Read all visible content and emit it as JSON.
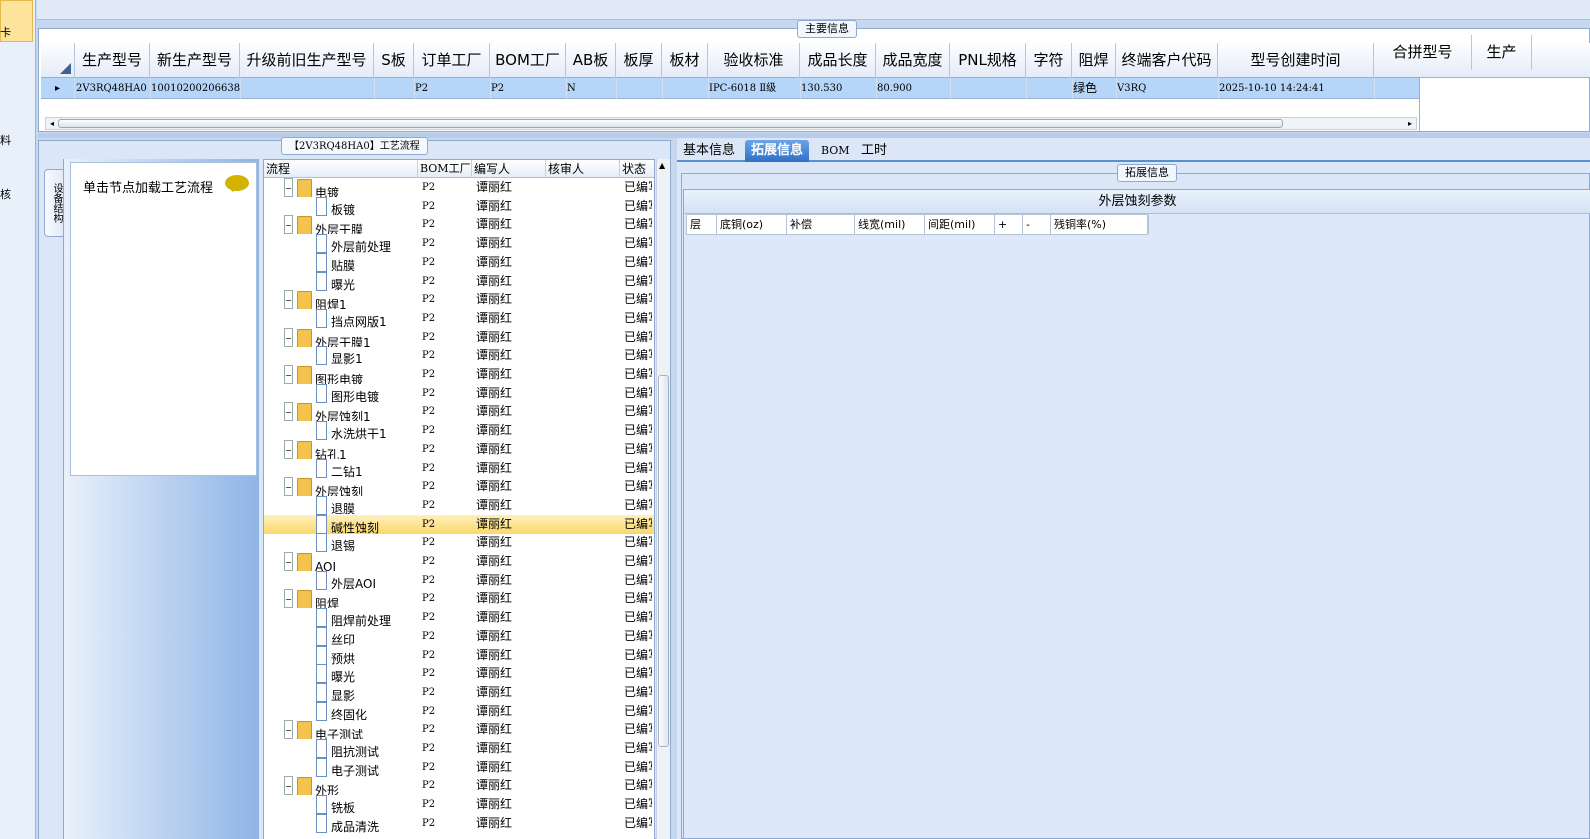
{
  "left_strip": {
    "labels": [
      "卡",
      "料",
      "核"
    ]
  },
  "main_info": {
    "title": "主要信息",
    "columns": [
      "生产型号",
      "新生产型号",
      "升级前旧生产型号",
      "S板",
      "订单工厂",
      "BOM工厂",
      "AB板",
      "板厚",
      "板材",
      "验收标准",
      "成品长度",
      "成品宽度",
      "PNL规格",
      "字符",
      "阻焊",
      "终端客户代码",
      "型号创建时间",
      "合拼型号",
      "生产"
    ],
    "row": [
      "2V3RQ48HA0",
      "10010200206638",
      "",
      "",
      "P2",
      "P2",
      "N",
      "",
      "",
      "IPC-6018 Ⅱ级",
      "130.530",
      "80.900",
      "",
      "",
      "绿色",
      "V3RQ",
      "2025-10-10 14:24:41"
    ]
  },
  "flow": {
    "title": "【2V3RQ48HA0】工艺流程",
    "side_tab": "设备结构",
    "node_hint": "单击节点加载工艺流程",
    "columns": [
      "流程",
      "BOM工厂",
      "编写人",
      "核审人",
      "状态"
    ],
    "rows": [
      {
        "name": "电镀",
        "level": 0,
        "bom": "P2",
        "writer": "谭丽红",
        "status": "已编写"
      },
      {
        "name": "板镀",
        "level": 1,
        "bom": "P2",
        "writer": "谭丽红",
        "status": "已编写"
      },
      {
        "name": "外层干膜",
        "level": 0,
        "bom": "P2",
        "writer": "谭丽红",
        "status": "已编写"
      },
      {
        "name": "外层前处理",
        "level": 1,
        "bom": "P2",
        "writer": "谭丽红",
        "status": "已编写"
      },
      {
        "name": "贴膜",
        "level": 1,
        "bom": "P2",
        "writer": "谭丽红",
        "status": "已编写"
      },
      {
        "name": "曝光",
        "level": 1,
        "bom": "P2",
        "writer": "谭丽红",
        "status": "已编写"
      },
      {
        "name": "阻焊1",
        "level": 0,
        "bom": "P2",
        "writer": "谭丽红",
        "status": "已编写"
      },
      {
        "name": "挡点网版1",
        "level": 1,
        "bom": "P2",
        "writer": "谭丽红",
        "status": "已编写"
      },
      {
        "name": "外层干膜1",
        "level": 0,
        "bom": "P2",
        "writer": "谭丽红",
        "status": "已编写"
      },
      {
        "name": "显影1",
        "level": 1,
        "bom": "P2",
        "writer": "谭丽红",
        "status": "已编写"
      },
      {
        "name": "图形电镀",
        "level": 0,
        "bom": "P2",
        "writer": "谭丽红",
        "status": "已编写"
      },
      {
        "name": "图形电镀",
        "level": 1,
        "bom": "P2",
        "writer": "谭丽红",
        "status": "已编写"
      },
      {
        "name": "外层蚀刻1",
        "level": 0,
        "bom": "P2",
        "writer": "谭丽红",
        "status": "已编写"
      },
      {
        "name": "水洗烘干1",
        "level": 1,
        "bom": "P2",
        "writer": "谭丽红",
        "status": "已编写"
      },
      {
        "name": "钻孔1",
        "level": 0,
        "bom": "P2",
        "writer": "谭丽红",
        "status": "已编写"
      },
      {
        "name": "二钻1",
        "level": 1,
        "bom": "P2",
        "writer": "谭丽红",
        "status": "已编写"
      },
      {
        "name": "外层蚀刻",
        "level": 0,
        "bom": "P2",
        "writer": "谭丽红",
        "status": "已编写"
      },
      {
        "name": "退膜",
        "level": 1,
        "bom": "P2",
        "writer": "谭丽红",
        "status": "已编写"
      },
      {
        "name": "碱性蚀刻",
        "level": 1,
        "bom": "P2",
        "writer": "谭丽红",
        "status": "已编写",
        "selected": true
      },
      {
        "name": "退锡",
        "level": 1,
        "bom": "P2",
        "writer": "谭丽红",
        "status": "已编写"
      },
      {
        "name": "AOI",
        "level": 0,
        "bom": "P2",
        "writer": "谭丽红",
        "status": "已编写"
      },
      {
        "name": "外层AOI",
        "level": 1,
        "bom": "P2",
        "writer": "谭丽红",
        "status": "已编写"
      },
      {
        "name": "阻焊",
        "level": 0,
        "bom": "P2",
        "writer": "谭丽红",
        "status": "已编写"
      },
      {
        "name": "阻焊前处理",
        "level": 1,
        "bom": "P2",
        "writer": "谭丽红",
        "status": "已编写"
      },
      {
        "name": "丝印",
        "level": 1,
        "bom": "P2",
        "writer": "谭丽红",
        "status": "已编写"
      },
      {
        "name": "预烘",
        "level": 1,
        "bom": "P2",
        "writer": "谭丽红",
        "status": "已编写"
      },
      {
        "name": "曝光",
        "level": 1,
        "bom": "P2",
        "writer": "谭丽红",
        "status": "已编写"
      },
      {
        "name": "显影",
        "level": 1,
        "bom": "P2",
        "writer": "谭丽红",
        "status": "已编写"
      },
      {
        "name": "终固化",
        "level": 1,
        "bom": "P2",
        "writer": "谭丽红",
        "status": "已编写"
      },
      {
        "name": "电子测试",
        "level": 0,
        "bom": "P2",
        "writer": "谭丽红",
        "status": "已编写"
      },
      {
        "name": "阻抗测试",
        "level": 1,
        "bom": "P2",
        "writer": "谭丽红",
        "status": "已编写"
      },
      {
        "name": "电子测试",
        "level": 1,
        "bom": "P2",
        "writer": "谭丽红",
        "status": "已编写"
      },
      {
        "name": "外形",
        "level": 0,
        "bom": "P2",
        "writer": "谭丽红",
        "status": "已编写"
      },
      {
        "name": "铣板",
        "level": 1,
        "bom": "P2",
        "writer": "谭丽红",
        "status": "已编写"
      },
      {
        "name": "成品清洗",
        "level": 1,
        "bom": "P2",
        "writer": "谭丽红",
        "status": "已编写"
      }
    ]
  },
  "detail": {
    "tabs": [
      "基本信息",
      "拓展信息",
      "BOM",
      "工时"
    ],
    "active_tab": "拓展信息",
    "ext_title": "拓展信息",
    "etch_title": "外层蚀刻参数",
    "etch_columns": [
      "层",
      "底铜(oz)",
      "补偿",
      "线宽(mil)",
      "间距(mil)",
      "+",
      "-",
      "残铜率(%)"
    ]
  }
}
